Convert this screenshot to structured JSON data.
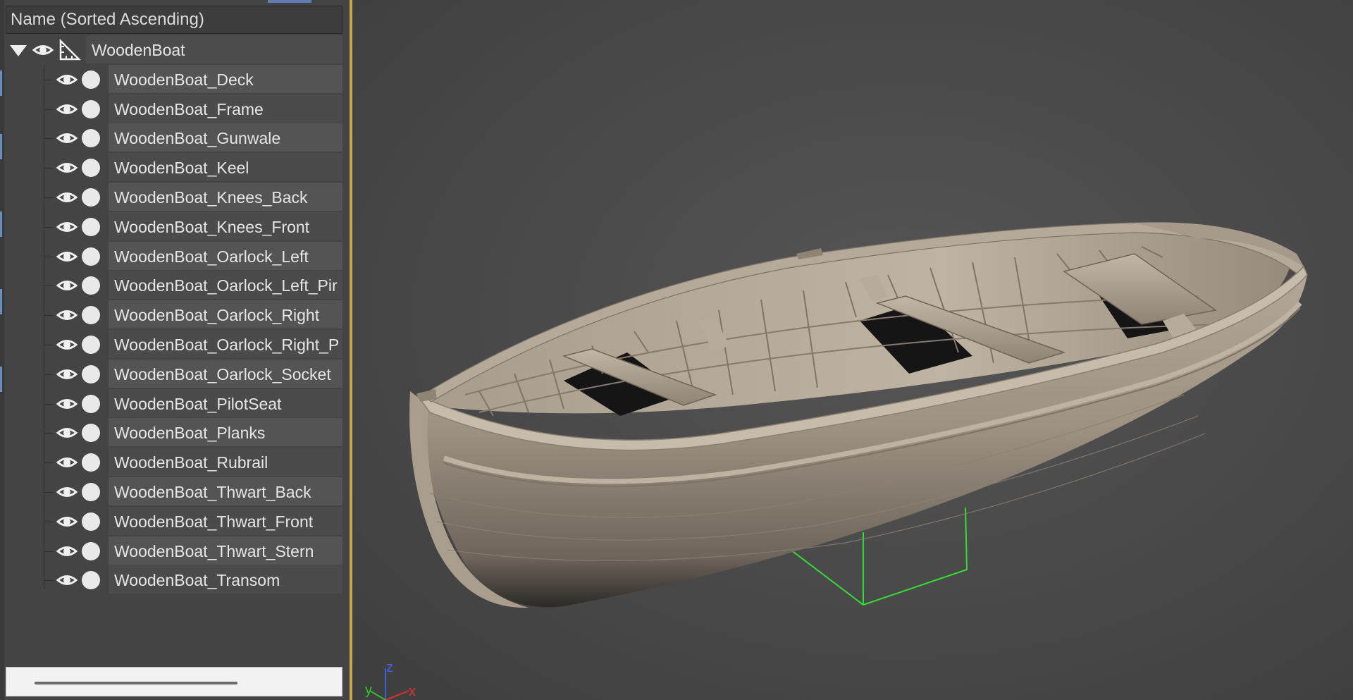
{
  "explorer": {
    "header_label": "Name (Sorted Ascending)",
    "root": {
      "name": "WoodenBoat",
      "expanded": true,
      "icons": [
        "expand-triangle-icon",
        "eye-icon",
        "geometry-triangle-icon"
      ]
    },
    "children": [
      {
        "name": "WoodenBoat_Deck"
      },
      {
        "name": "WoodenBoat_Frame"
      },
      {
        "name": "WoodenBoat_Gunwale"
      },
      {
        "name": "WoodenBoat_Keel"
      },
      {
        "name": "WoodenBoat_Knees_Back"
      },
      {
        "name": "WoodenBoat_Knees_Front"
      },
      {
        "name": "WoodenBoat_Oarlock_Left"
      },
      {
        "name": "WoodenBoat_Oarlock_Left_Pir"
      },
      {
        "name": "WoodenBoat_Oarlock_Right"
      },
      {
        "name": "WoodenBoat_Oarlock_Right_P"
      },
      {
        "name": "WoodenBoat_Oarlock_Socket"
      },
      {
        "name": "WoodenBoat_PilotSeat"
      },
      {
        "name": "WoodenBoat_Planks"
      },
      {
        "name": "WoodenBoat_Rubrail"
      },
      {
        "name": "WoodenBoat_Thwart_Back"
      },
      {
        "name": "WoodenBoat_Thwart_Front"
      },
      {
        "name": "WoodenBoat_Thwart_Stern"
      },
      {
        "name": "WoodenBoat_Transom"
      }
    ],
    "child_icons": [
      "eye-icon",
      "object-dot-icon"
    ]
  },
  "viewport": {
    "axis_labels": {
      "z": "z",
      "y": "y",
      "x": "x"
    },
    "colors": {
      "background": "#4a4a4a",
      "hull": "#9c8f80",
      "bounding_box": "#33dd33",
      "accent_divider": "#c8a64a",
      "axis_x": "#e03030",
      "axis_y": "#30c030",
      "axis_z": "#4060e0"
    }
  }
}
